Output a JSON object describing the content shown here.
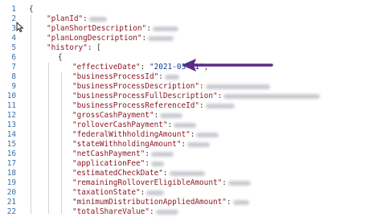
{
  "editor": {
    "lines": [
      {
        "num": "1",
        "indent": 0,
        "kind": "brace",
        "text": "{"
      },
      {
        "num": "2",
        "indent": 1,
        "kind": "blurred",
        "key": "\"planId\"",
        "blur_w": 22
      },
      {
        "num": "3",
        "indent": 1,
        "kind": "blurred",
        "key": "\"planShortDescription\"",
        "blur_w": 32
      },
      {
        "num": "4",
        "indent": 1,
        "kind": "blurred",
        "key": "\"planLongDescription\"",
        "blur_w": 32
      },
      {
        "num": "5",
        "indent": 1,
        "kind": "open",
        "key": "\"history\"",
        "after": ": ["
      },
      {
        "num": "6",
        "indent": 2,
        "kind": "brace",
        "text": "{"
      },
      {
        "num": "7",
        "indent": 3,
        "kind": "value",
        "key": "\"effectiveDate\"",
        "value": "\"2021-03-31\""
      },
      {
        "num": "8",
        "indent": 3,
        "kind": "blurred",
        "key": "\"businessProcessId\"",
        "blur_w": 18
      },
      {
        "num": "9",
        "indent": 3,
        "kind": "blurred",
        "key": "\"businessProcessDescription\"",
        "blur_w": 80
      },
      {
        "num": "10",
        "indent": 3,
        "kind": "blurred",
        "key": "\"businessProcessFullDescription\"",
        "blur_w": 120
      },
      {
        "num": "11",
        "indent": 3,
        "kind": "blurred",
        "key": "\"businessProcessReferenceId\"",
        "blur_w": 36
      },
      {
        "num": "12",
        "indent": 3,
        "kind": "blurred",
        "key": "\"grossCashPayment\"",
        "blur_w": 28
      },
      {
        "num": "13",
        "indent": 3,
        "kind": "blurred",
        "key": "\"rolloverCashPayment\"",
        "blur_w": 28
      },
      {
        "num": "14",
        "indent": 3,
        "kind": "blurred",
        "key": "\"federalWithholdingAmount\"",
        "blur_w": 28
      },
      {
        "num": "15",
        "indent": 3,
        "kind": "blurred",
        "key": "\"stateWithholdingAmount\"",
        "blur_w": 28
      },
      {
        "num": "16",
        "indent": 3,
        "kind": "blurred",
        "key": "\"netCashPayment\"",
        "blur_w": 28
      },
      {
        "num": "17",
        "indent": 3,
        "kind": "blurred",
        "key": "\"applicationFee\"",
        "blur_w": 16
      },
      {
        "num": "18",
        "indent": 3,
        "kind": "blurred",
        "key": "\"estimatedCheckDate\"",
        "blur_w": 44
      },
      {
        "num": "19",
        "indent": 3,
        "kind": "blurred",
        "key": "\"remainingRolloverEligibleAmount\"",
        "blur_w": 28
      },
      {
        "num": "20",
        "indent": 3,
        "kind": "blurred",
        "key": "\"taxationState\"",
        "blur_w": 22
      },
      {
        "num": "21",
        "indent": 3,
        "kind": "blurred",
        "key": "\"minimumDistributionAppliedAmount\"",
        "blur_w": 20
      },
      {
        "num": "22",
        "indent": 3,
        "kind": "blurred",
        "key": "\"totalShareValue\"",
        "blur_w": 28
      }
    ]
  },
  "annotation": {
    "arrow_color": "#5b2a86",
    "icon": "arrow-left-icon"
  },
  "cursor": {
    "icon": "mouse-pointer-icon"
  }
}
